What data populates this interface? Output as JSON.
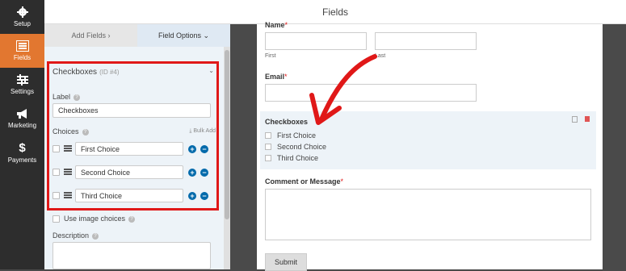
{
  "header": {
    "title": "Fields"
  },
  "nav": {
    "items": [
      {
        "label": "Setup",
        "icon": "gear-icon"
      },
      {
        "label": "Fields",
        "icon": "fields-icon",
        "active": true
      },
      {
        "label": "Settings",
        "icon": "sliders-icon"
      },
      {
        "label": "Marketing",
        "icon": "megaphone-icon"
      },
      {
        "label": "Payments",
        "icon": "dollar-icon"
      }
    ]
  },
  "panel": {
    "tabs": [
      {
        "label": "Add Fields ›"
      },
      {
        "label": "Field Options ⌄"
      }
    ],
    "field_title": "Checkboxes",
    "field_id": "(ID #4)",
    "label_label": "Label",
    "label_value": "Checkboxes",
    "choices_label": "Choices",
    "bulk_add": "Bulk Add",
    "choices": [
      "First Choice",
      "Second Choice",
      "Third Choice"
    ],
    "use_image_choices": "Use image choices",
    "description_label": "Description"
  },
  "preview": {
    "name_label": "Name",
    "first_sub": "First",
    "last_sub": "Last",
    "email_label": "Email",
    "checkboxes_label": "Checkboxes",
    "options": [
      "First Choice",
      "Second Choice",
      "Third Choice"
    ],
    "comment_label": "Comment or Message",
    "required_mark": "*",
    "submit_label": "Submit"
  },
  "colors": {
    "accent": "#e27730",
    "highlight": "#e01818",
    "link": "#036aab"
  }
}
